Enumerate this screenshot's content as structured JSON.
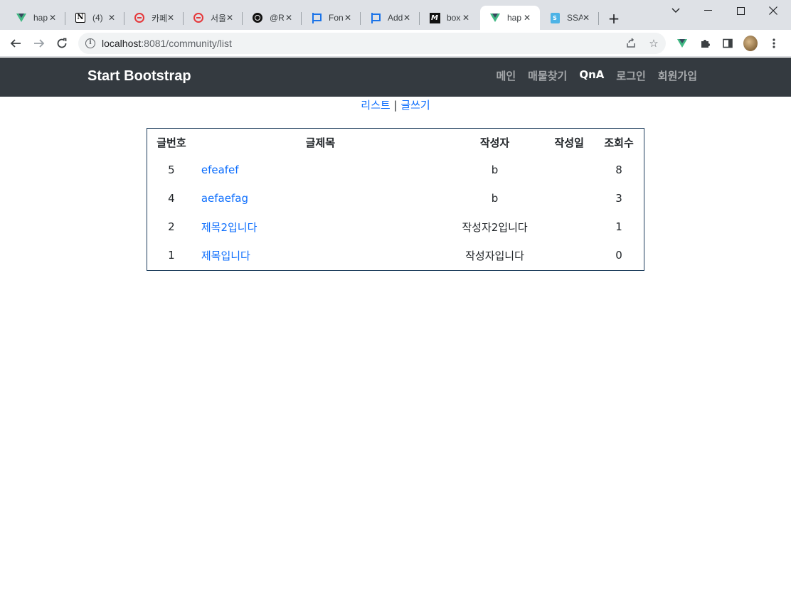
{
  "browser": {
    "tabs": [
      {
        "icon": "vue-icon",
        "title": "hap",
        "active": false
      },
      {
        "icon": "notion-icon",
        "title": "(4)",
        "active": false
      },
      {
        "icon": "ring-icon",
        "title": "카페",
        "active": false
      },
      {
        "icon": "ring-icon",
        "title": "서울",
        "active": false
      },
      {
        "icon": "github-icon",
        "title": "@R",
        "active": false
      },
      {
        "icon": "flag-icon",
        "title": "Fon",
        "active": false
      },
      {
        "icon": "flag-icon",
        "title": "Add",
        "active": false
      },
      {
        "icon": "m-icon",
        "title": "box",
        "active": false
      },
      {
        "icon": "vue-icon",
        "title": "hap",
        "active": true
      },
      {
        "icon": "doc-icon",
        "title": "SSA",
        "active": false
      }
    ],
    "address": {
      "host": "localhost",
      "path": ":8081/community/list"
    }
  },
  "navbar": {
    "brand": "Start Bootstrap",
    "links": [
      "메인",
      "매물찾기",
      "QnA",
      "로그인",
      "회원가입"
    ],
    "active_link": "QnA"
  },
  "sublinks": {
    "list": "리스트",
    "separator": "|",
    "write": "글쓰기"
  },
  "board": {
    "columns": [
      "글번호",
      "글제목",
      "작성자",
      "작성일",
      "조회수"
    ],
    "rows": [
      {
        "no": "5",
        "title": "efeafef",
        "writer": "b",
        "date": "",
        "views": "8"
      },
      {
        "no": "4",
        "title": "aefaefag",
        "writer": "b",
        "date": "",
        "views": "3"
      },
      {
        "no": "2",
        "title": "제목2입니다",
        "writer": "작성자2입니다",
        "date": "",
        "views": "1"
      },
      {
        "no": "1",
        "title": "제목입니다",
        "writer": "작성자입니다",
        "date": "",
        "views": "0"
      }
    ]
  },
  "colors": {
    "navbar_bg": "#343a40",
    "link": "#0d6efd",
    "table_border": "#1d3d5c"
  }
}
